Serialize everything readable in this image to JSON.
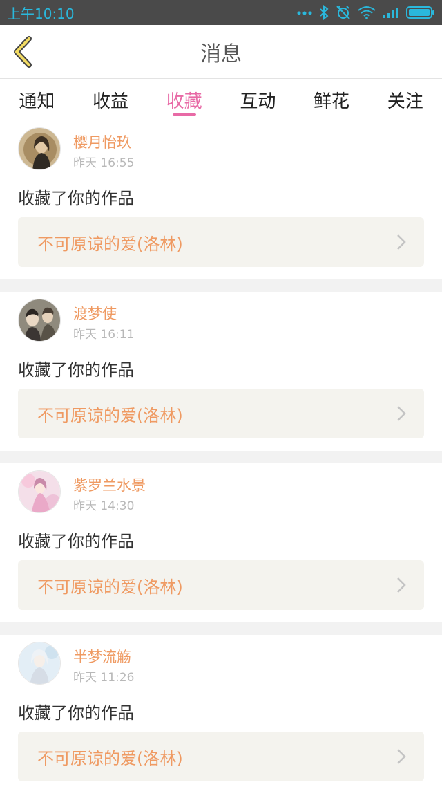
{
  "status_bar": {
    "time": "上午10:10",
    "icons": [
      "dots-icon",
      "bluetooth-icon",
      "alarm-off-icon",
      "wifi-icon",
      "signal-icon",
      "battery-icon"
    ]
  },
  "header": {
    "title": "消息",
    "back_icon": "chevron-left-icon"
  },
  "tabs": [
    {
      "label": "通知",
      "active": false
    },
    {
      "label": "收益",
      "active": false
    },
    {
      "label": "收藏",
      "active": true
    },
    {
      "label": "互动",
      "active": false
    },
    {
      "label": "鲜花",
      "active": false
    },
    {
      "label": "关注",
      "active": false
    }
  ],
  "messages": [
    {
      "user": "樱月怡玖",
      "time": "昨天 16:55",
      "action": "收藏了你的作品",
      "work": "不可原谅的爱(洛林)"
    },
    {
      "user": "渡梦使",
      "time": "昨天 16:11",
      "action": "收藏了你的作品",
      "work": "不可原谅的爱(洛林)"
    },
    {
      "user": "紫罗兰水景",
      "time": "昨天 14:30",
      "action": "收藏了你的作品",
      "work": "不可原谅的爱(洛林)"
    },
    {
      "user": "半梦流觞",
      "time": "昨天 11:26",
      "action": "收藏了你的作品",
      "work": "不可原谅的爱(洛林)"
    }
  ],
  "colors": {
    "accent": "#e86aa6",
    "username": "#ef9a62",
    "status_bar": "#4a4a4a",
    "status_icons": "#2ab8dc"
  }
}
